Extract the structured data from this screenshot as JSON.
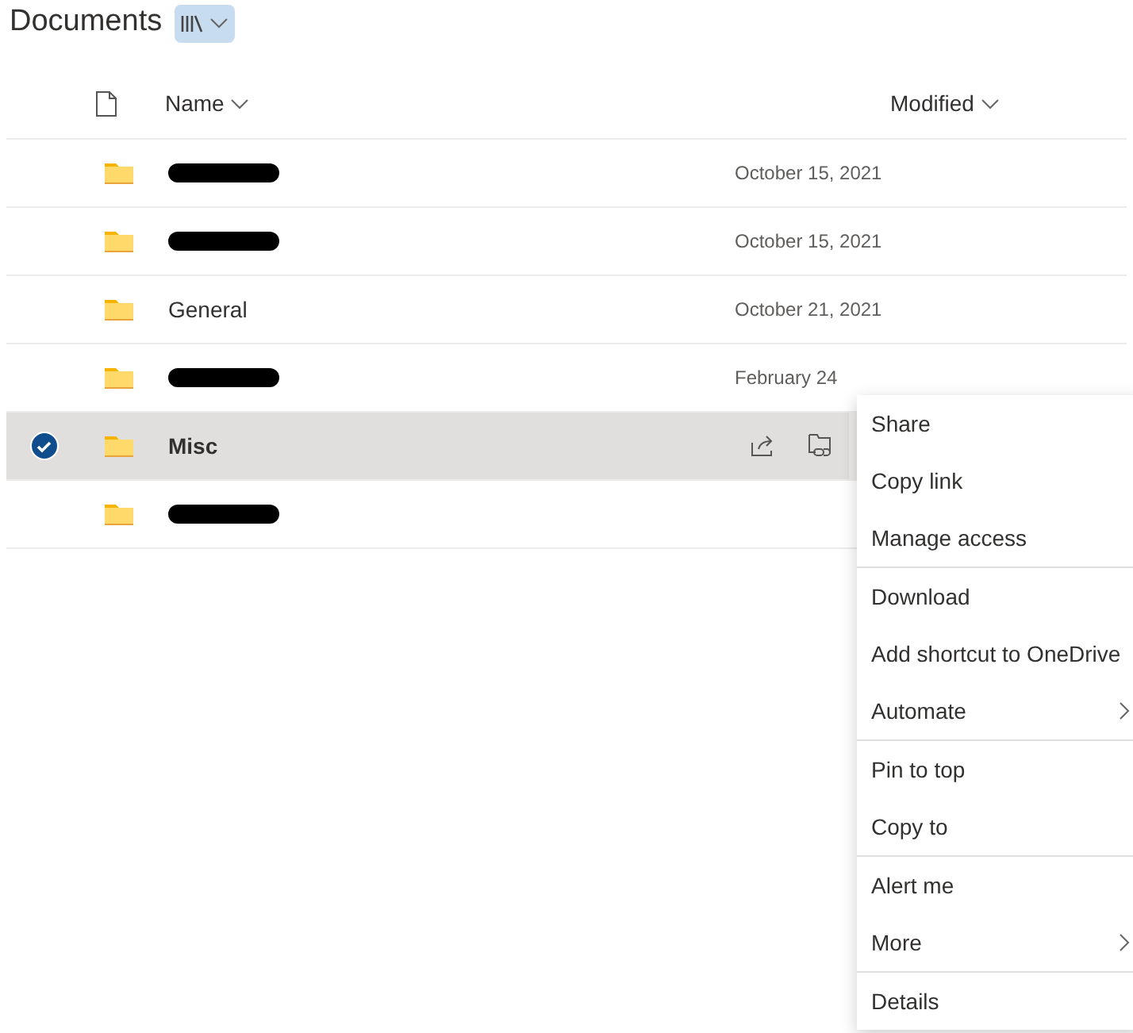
{
  "title": "Documents",
  "columns": [
    {
      "label": "Name"
    },
    {
      "label": "Modified"
    }
  ],
  "rows": [
    {
      "kind": "redacted",
      "modified": "October 15, 2021",
      "selected": false
    },
    {
      "kind": "redacted",
      "modified": "October 15, 2021",
      "selected": false
    },
    {
      "kind": "named",
      "name": "General",
      "modified": "October 21, 2021",
      "selected": false
    },
    {
      "kind": "redacted",
      "modified": "February 24",
      "selected": false
    },
    {
      "kind": "named",
      "name": "Misc",
      "selected": true
    },
    {
      "kind": "redacted",
      "selected": false
    }
  ],
  "context_menu": [
    [
      {
        "label": "Share",
        "submenu": false
      },
      {
        "label": "Copy link",
        "submenu": false
      },
      {
        "label": "Manage access",
        "submenu": false
      }
    ],
    [
      {
        "label": "Download",
        "submenu": false
      },
      {
        "label": "Add shortcut to OneDrive",
        "submenu": false
      },
      {
        "label": "Automate",
        "submenu": true
      }
    ],
    [
      {
        "label": "Pin to top",
        "submenu": false
      },
      {
        "label": "Copy to",
        "submenu": false
      }
    ],
    [
      {
        "label": "Alert me",
        "submenu": false
      },
      {
        "label": "More",
        "submenu": true
      }
    ],
    [
      {
        "label": "Details",
        "submenu": false
      }
    ]
  ]
}
